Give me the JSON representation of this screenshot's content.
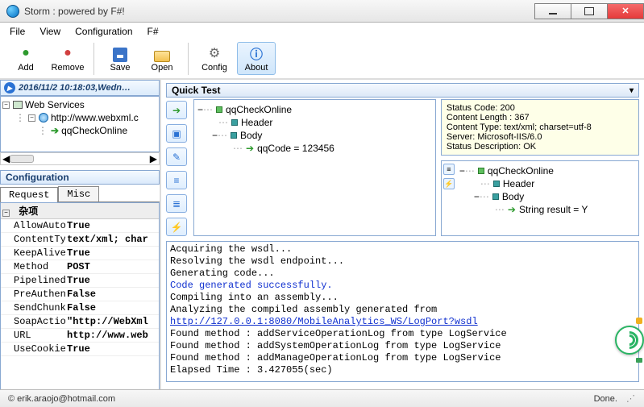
{
  "window": {
    "title": "Storm : powered by F#!"
  },
  "menu": {
    "file": "File",
    "view": "View",
    "configuration": "Configuration",
    "fsharp": "F#"
  },
  "toolbar": {
    "add": "Add",
    "remove": "Remove",
    "save": "Save",
    "open": "Open",
    "config": "Config",
    "about": "About"
  },
  "timestamp": "2016/11/2 10:18:03,Wedn…",
  "services_tree": {
    "root": "Web Services",
    "endpoint": "http://www.webxml.c",
    "operation": "qqCheckOnline"
  },
  "config": {
    "header": "Configuration",
    "tabs": {
      "request": "Request",
      "misc": "Misc"
    },
    "category": "杂项",
    "props": [
      {
        "k": "AllowAutoR",
        "v": "True"
      },
      {
        "k": "ContentTyp",
        "v": "text/xml; char"
      },
      {
        "k": "KeepAlive",
        "v": "True"
      },
      {
        "k": "Method",
        "v": "POST"
      },
      {
        "k": "Pipelined",
        "v": "True"
      },
      {
        "k": "PreAuthent",
        "v": "False"
      },
      {
        "k": "SendChunke",
        "v": "False"
      },
      {
        "k": "SoapAction",
        "v": "\"http://WebXml"
      },
      {
        "k": "URL",
        "v": "http://www.web"
      },
      {
        "k": "UseCookieC",
        "v": "True"
      }
    ]
  },
  "quicktest": {
    "title": "Quick Test",
    "request": {
      "root": "qqCheckOnline",
      "header": "Header",
      "body": "Body",
      "param": "qqCode = 123456"
    },
    "response_status": {
      "l1": "Status Code: 200",
      "l2": "Content Length : 367",
      "l3": "Content Type: text/xml; charset=utf-8",
      "l4": "Server: Microsoft-IIS/6.0",
      "l5": "Status Description: OK"
    },
    "response_tree": {
      "root": "qqCheckOnline",
      "header": "Header",
      "body": "Body",
      "result": "String result = Y"
    }
  },
  "console": {
    "l1": "Acquiring the wsdl...",
    "l2": "Resolving the wsdl endpoint...",
    "l3": "Generating code...",
    "l4": "Code generated successfully.",
    "l5": "Compiling into an assembly...",
    "l6": "Analyzing the compiled assembly generated from",
    "l7_link": "http://127.0.0.1:8080/MobileAnalytics_WS/LogPort?wsdl",
    "l8": "Found method : addServiceOperationLog from type LogService",
    "l9": "Found method : addSystemOperationLog from type LogService",
    "l10": "Found method : addManageOperationLog from type LogService",
    "l11": "Elapsed Time : 3.427055(sec)"
  },
  "status": {
    "left": "© erik.araojo@hotmail.com",
    "right": "Done."
  }
}
